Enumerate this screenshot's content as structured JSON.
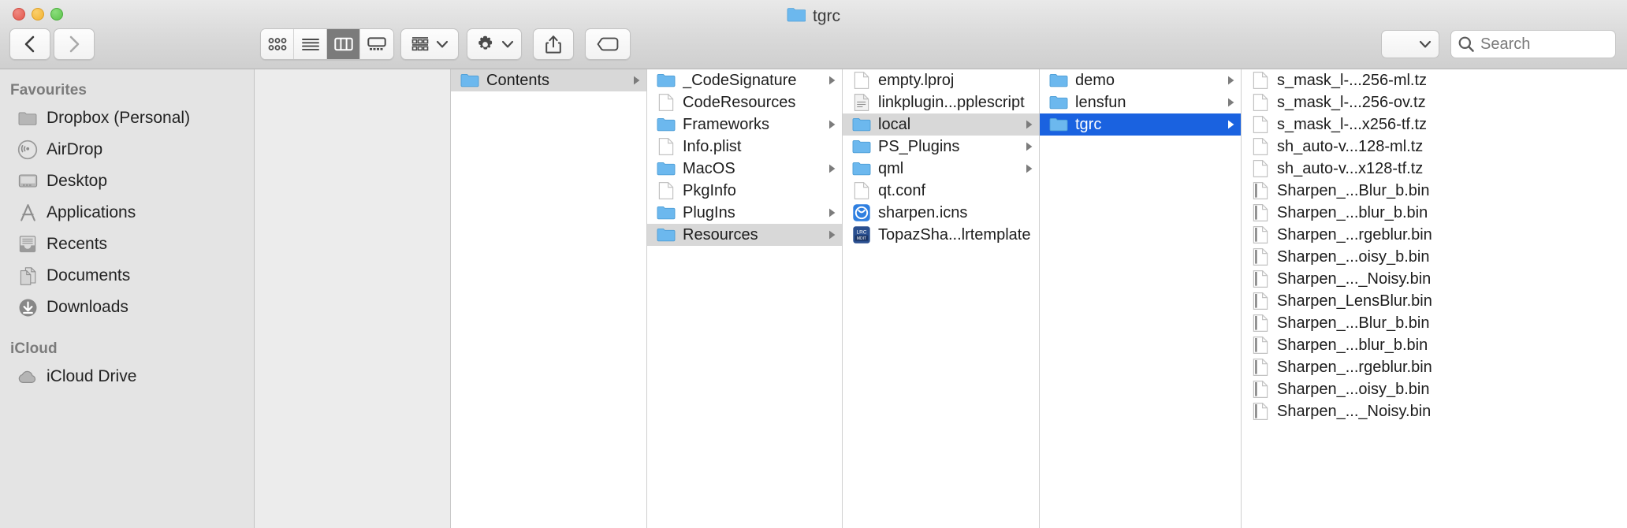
{
  "window": {
    "title": "tgrc",
    "title_icon": "folder-icon",
    "traffic_lights": [
      {
        "name": "close-button",
        "color": "#e2574c"
      },
      {
        "name": "minimize-button",
        "color": "#f2b232"
      },
      {
        "name": "zoom-button",
        "color": "#5cc24b"
      }
    ]
  },
  "toolbar": {
    "back_label": "‹",
    "forward_label": "›",
    "view_modes": [
      {
        "name": "icon-view-button",
        "active": false
      },
      {
        "name": "list-view-button",
        "active": false
      },
      {
        "name": "column-view-button",
        "active": true
      },
      {
        "name": "gallery-view-button",
        "active": false
      }
    ],
    "arrange_button": "group-items-button",
    "action_button": "action-gear-button",
    "share_button": "share-button",
    "tag_button": "tag-button",
    "sort_popup": "sort-popup-button",
    "search_placeholder": "Search"
  },
  "sidebar": {
    "sections": [
      {
        "header": "Favourites",
        "items": [
          {
            "label": "Dropbox (Personal)",
            "icon": "folder-icon"
          },
          {
            "label": "AirDrop",
            "icon": "airdrop-icon"
          },
          {
            "label": "Desktop",
            "icon": "desktop-icon"
          },
          {
            "label": "Applications",
            "icon": "applications-icon"
          },
          {
            "label": "Recents",
            "icon": "recents-icon"
          },
          {
            "label": "Documents",
            "icon": "documents-icon"
          },
          {
            "label": "Downloads",
            "icon": "downloads-icon"
          }
        ]
      },
      {
        "header": "iCloud",
        "items": [
          {
            "label": "iCloud Drive",
            "icon": "cloud-icon"
          }
        ]
      }
    ]
  },
  "columns": [
    {
      "name": "column-0",
      "rows": []
    },
    {
      "name": "column-contents",
      "rows": [
        {
          "label": "Contents",
          "icon": "folder-icon",
          "arrow": true,
          "selected": "inactive"
        }
      ]
    },
    {
      "name": "column-bundle-contents",
      "rows": [
        {
          "label": "_CodeSignature",
          "icon": "folder-icon",
          "arrow": true,
          "selected": "none"
        },
        {
          "label": "CodeResources",
          "icon": "file-icon",
          "arrow": false,
          "selected": "none"
        },
        {
          "label": "Frameworks",
          "icon": "folder-icon",
          "arrow": true,
          "selected": "none"
        },
        {
          "label": "Info.plist",
          "icon": "file-icon",
          "arrow": false,
          "selected": "none"
        },
        {
          "label": "MacOS",
          "icon": "folder-icon",
          "arrow": true,
          "selected": "none"
        },
        {
          "label": "PkgInfo",
          "icon": "file-icon",
          "arrow": false,
          "selected": "none"
        },
        {
          "label": "PlugIns",
          "icon": "folder-icon",
          "arrow": true,
          "selected": "none"
        },
        {
          "label": "Resources",
          "icon": "folder-icon",
          "arrow": true,
          "selected": "inactive"
        }
      ]
    },
    {
      "name": "column-resources",
      "rows": [
        {
          "label": "empty.lproj",
          "icon": "file-icon",
          "arrow": false,
          "selected": "none"
        },
        {
          "label": "linkplugin...pplescript",
          "icon": "applescript-icon",
          "arrow": false,
          "selected": "none"
        },
        {
          "label": "local",
          "icon": "folder-icon",
          "arrow": true,
          "selected": "inactive"
        },
        {
          "label": "PS_Plugins",
          "icon": "folder-icon",
          "arrow": true,
          "selected": "none"
        },
        {
          "label": "qml",
          "icon": "folder-icon",
          "arrow": true,
          "selected": "none"
        },
        {
          "label": "qt.conf",
          "icon": "file-icon",
          "arrow": false,
          "selected": "none"
        },
        {
          "label": "sharpen.icns",
          "icon": "icns-icon",
          "arrow": false,
          "selected": "none"
        },
        {
          "label": "TopazSha...lrtemplate",
          "icon": "lrtemplate-icon",
          "arrow": false,
          "selected": "none"
        }
      ]
    },
    {
      "name": "column-local",
      "rows": [
        {
          "label": "demo",
          "icon": "folder-icon",
          "arrow": true,
          "selected": "none"
        },
        {
          "label": "lensfun",
          "icon": "folder-icon",
          "arrow": true,
          "selected": "none"
        },
        {
          "label": "tgrc",
          "icon": "folder-icon",
          "arrow": true,
          "selected": "active"
        }
      ]
    },
    {
      "name": "column-tgrc",
      "rows": [
        {
          "label": "s_mask_l-...256-ml.tz",
          "icon": "file-icon",
          "arrow": false,
          "selected": "none"
        },
        {
          "label": "s_mask_l-...256-ov.tz",
          "icon": "file-icon",
          "arrow": false,
          "selected": "none"
        },
        {
          "label": "s_mask_l-...x256-tf.tz",
          "icon": "file-icon",
          "arrow": false,
          "selected": "none"
        },
        {
          "label": "sh_auto-v...128-ml.tz",
          "icon": "file-icon",
          "arrow": false,
          "selected": "none"
        },
        {
          "label": "sh_auto-v...x128-tf.tz",
          "icon": "file-icon",
          "arrow": false,
          "selected": "none"
        },
        {
          "label": "Sharpen_...Blur_b.bin",
          "icon": "bin-icon",
          "arrow": false,
          "selected": "none"
        },
        {
          "label": "Sharpen_...blur_b.bin",
          "icon": "bin-icon",
          "arrow": false,
          "selected": "none"
        },
        {
          "label": "Sharpen_...rgeblur.bin",
          "icon": "bin-icon",
          "arrow": false,
          "selected": "none"
        },
        {
          "label": "Sharpen_...oisy_b.bin",
          "icon": "bin-icon",
          "arrow": false,
          "selected": "none"
        },
        {
          "label": "Sharpen_..._Noisy.bin",
          "icon": "bin-icon",
          "arrow": false,
          "selected": "none"
        },
        {
          "label": "Sharpen_LensBlur.bin",
          "icon": "bin-icon",
          "arrow": false,
          "selected": "none"
        },
        {
          "label": "Sharpen_...Blur_b.bin",
          "icon": "bin-icon",
          "arrow": false,
          "selected": "none"
        },
        {
          "label": "Sharpen_...blur_b.bin",
          "icon": "bin-icon",
          "arrow": false,
          "selected": "none"
        },
        {
          "label": "Sharpen_...rgeblur.bin",
          "icon": "bin-icon",
          "arrow": false,
          "selected": "none"
        },
        {
          "label": "Sharpen_...oisy_b.bin",
          "icon": "bin-icon",
          "arrow": false,
          "selected": "none"
        },
        {
          "label": "Sharpen_..._Noisy.bin",
          "icon": "bin-icon",
          "arrow": false,
          "selected": "none"
        }
      ]
    }
  ],
  "colors": {
    "selection_blue": "#1a62e0",
    "selection_grey": "#d8d8d8",
    "folder_blue": "#6cb8ee",
    "sidebar_bg": "#e4e4e4"
  }
}
